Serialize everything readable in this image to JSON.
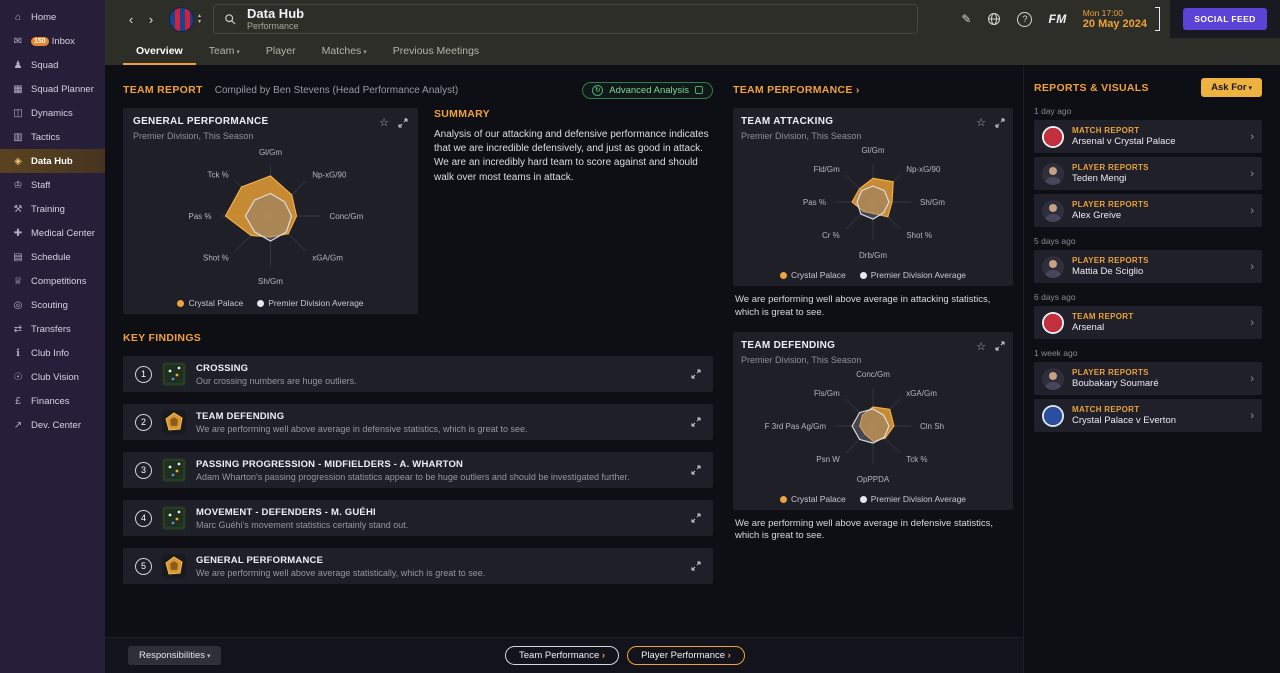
{
  "titlebar": {
    "title": "Data Hub",
    "subtitle": "Performance",
    "date_line1": "Mon 17:00",
    "date_line2": "20 May 2024",
    "fm_label": "FM",
    "social_feed_label": "SOCIAL FEED"
  },
  "sidebar": {
    "items": [
      {
        "label": "Home",
        "icon": "home-icon"
      },
      {
        "label": "Inbox",
        "icon": "inbox-icon",
        "badge": "150"
      },
      {
        "label": "Squad",
        "icon": "squad-icon"
      },
      {
        "label": "Squad Planner",
        "icon": "squad-planner-icon"
      },
      {
        "label": "Dynamics",
        "icon": "dynamics-icon"
      },
      {
        "label": "Tactics",
        "icon": "tactics-icon"
      },
      {
        "label": "Data Hub",
        "icon": "data-hub-icon",
        "active": true
      },
      {
        "label": "Staff",
        "icon": "staff-icon"
      },
      {
        "label": "Training",
        "icon": "training-icon"
      },
      {
        "label": "Medical Center",
        "icon": "medical-icon"
      },
      {
        "label": "Schedule",
        "icon": "schedule-icon"
      },
      {
        "label": "Competitions",
        "icon": "competitions-icon"
      },
      {
        "label": "Scouting",
        "icon": "scouting-icon"
      },
      {
        "label": "Transfers",
        "icon": "transfers-icon"
      },
      {
        "label": "Club Info",
        "icon": "club-info-icon"
      },
      {
        "label": "Club Vision",
        "icon": "club-vision-icon"
      },
      {
        "label": "Finances",
        "icon": "finances-icon"
      },
      {
        "label": "Dev. Center",
        "icon": "dev-center-icon"
      }
    ]
  },
  "tabs": [
    {
      "label": "Overview",
      "active": true
    },
    {
      "label": "Team",
      "dropdown": true
    },
    {
      "label": "Player"
    },
    {
      "label": "Matches",
      "dropdown": true
    },
    {
      "label": "Previous Meetings"
    }
  ],
  "team_report": {
    "title": "TEAM REPORT",
    "compiled_by": "Compiled by Ben Stevens (Head Performance Analyst)",
    "advanced_analysis_label": "Advanced Analysis"
  },
  "summary": {
    "title": "SUMMARY",
    "text": "Analysis of our attacking and defensive performance indicates that we are incredible defensively, and just as good in attack. We are an incredibly hard team to score against and should walk over most teams in attack."
  },
  "key_findings": {
    "title": "KEY FINDINGS",
    "items": [
      {
        "num": "1",
        "title": "CROSSING",
        "desc": "Our crossing numbers are huge outliers.",
        "thumb": "pitch"
      },
      {
        "num": "2",
        "title": "TEAM DEFENDING",
        "desc": "We are performing well above average in defensive statistics, which is great to see.",
        "thumb": "radar"
      },
      {
        "num": "3",
        "title": "PASSING PROGRESSION - MIDFIELDERS - A. WHARTON",
        "desc": "Adam Wharton's passing progression statistics appear to be huge outliers and should be investigated further.",
        "thumb": "pitch"
      },
      {
        "num": "4",
        "title": "MOVEMENT - DEFENDERS - M. GUÉHI",
        "desc": "Marc Guéhi's movement statistics certainly stand out.",
        "thumb": "pitch"
      },
      {
        "num": "5",
        "title": "GENERAL PERFORMANCE",
        "desc": "We are performing well above average statistically, which is great to see.",
        "thumb": "radar"
      }
    ]
  },
  "team_performance": {
    "header": "TEAM PERFORMANCE",
    "attacking_note": "We are performing well above average in attacking statistics, which is great to see.",
    "defending_note": "We are performing well above average in defensive statistics, which is great to see."
  },
  "reports": {
    "title": "REPORTS & VISUALS",
    "ask_for_label": "Ask For",
    "items": [
      {
        "type": "label",
        "text": "1 day ago"
      },
      {
        "type": "report",
        "kind": "MATCH REPORT",
        "name": "Arsenal v Crystal Palace",
        "icon": "arsenal-crest-icon"
      },
      {
        "type": "report",
        "kind": "PLAYER REPORTS",
        "name": "Teden Mengi",
        "icon": "player-avatar-icon"
      },
      {
        "type": "report",
        "kind": "PLAYER REPORTS",
        "name": "Alex Greive",
        "icon": "player-avatar-icon"
      },
      {
        "type": "label",
        "text": "5 days ago"
      },
      {
        "type": "report",
        "kind": "PLAYER REPORTS",
        "name": "Mattia De Sciglio",
        "icon": "player-avatar-icon"
      },
      {
        "type": "label",
        "text": "6 days ago"
      },
      {
        "type": "report",
        "kind": "TEAM REPORT",
        "name": "Arsenal",
        "icon": "arsenal-crest-icon"
      },
      {
        "type": "label",
        "text": "1 week ago"
      },
      {
        "type": "report",
        "kind": "PLAYER REPORTS",
        "name": "Boubakary Soumaré",
        "icon": "player-avatar-icon"
      },
      {
        "type": "report",
        "kind": "MATCH REPORT",
        "name": "Crystal Palace v Everton",
        "icon": "everton-crest-icon"
      }
    ]
  },
  "footer": {
    "responsibilities_label": "Responsibilities",
    "team_performance_label": "Team Performance",
    "player_performance_label": "Player Performance"
  },
  "chart_data": [
    {
      "type": "radar",
      "id": "general-performance",
      "title": "GENERAL PERFORMANCE",
      "subtitle": "Premier Division, This Season",
      "axes": [
        "Gl/Gm",
        "Np-xG/90",
        "Conc/Gm",
        "xGA/Gm",
        "Sh/Gm",
        "Shot %",
        "Pas %",
        "Tck %"
      ],
      "range": [
        0,
        1
      ],
      "series": [
        {
          "name": "Crystal Palace",
          "color": "#f2ae4a",
          "fill": "rgba(228,158,52,0.85)",
          "values": [
            0.8,
            0.6,
            0.52,
            0.5,
            0.42,
            0.55,
            0.9,
            0.82
          ]
        },
        {
          "name": "Premier Division Average",
          "color": "#dcdce4",
          "fill": "rgba(130,130,142,0.38)",
          "values": [
            0.45,
            0.4,
            0.42,
            0.45,
            0.5,
            0.45,
            0.5,
            0.45
          ]
        }
      ]
    },
    {
      "type": "radar",
      "id": "team-attacking",
      "title": "TEAM ATTACKING",
      "subtitle": "Premier Division, This Season",
      "axes": [
        "Gl/Gm",
        "Np-xG/90",
        "Sh/Gm",
        "Shot %",
        "Drb/Gm",
        "Cr %",
        "Pas %",
        "Fld/Gm"
      ],
      "range": [
        0,
        1
      ],
      "series": [
        {
          "name": "Crystal Palace",
          "color": "#f2ae4a",
          "fill": "rgba(228,158,52,0.85)",
          "values": [
            0.62,
            0.75,
            0.5,
            0.55,
            0.3,
            0.35,
            0.55,
            0.5
          ]
        },
        {
          "name": "Premier Division Average",
          "color": "#dcdce4",
          "fill": "rgba(130,130,142,0.38)",
          "values": [
            0.42,
            0.42,
            0.42,
            0.4,
            0.45,
            0.45,
            0.42,
            0.42
          ]
        }
      ]
    },
    {
      "type": "radar",
      "id": "team-defending",
      "title": "TEAM DEFENDING",
      "subtitle": "Premier Division, This Season",
      "axes": [
        "Conc/Gm",
        "xGA/Gm",
        "Cln Sh",
        "Tck %",
        "OpPPDA",
        "Psn W",
        "F 3rd Pas Ag/Gm",
        "Fls/Gm"
      ],
      "range": [
        0,
        1
      ],
      "series": [
        {
          "name": "Crystal Palace",
          "color": "#f2ae4a",
          "fill": "rgba(228,158,52,0.85)",
          "values": [
            0.5,
            0.62,
            0.55,
            0.45,
            0.4,
            0.3,
            0.35,
            0.4
          ]
        },
        {
          "name": "Premier Division Average",
          "color": "#dcdce4",
          "fill": "rgba(130,130,142,0.38)",
          "values": [
            0.45,
            0.4,
            0.42,
            0.42,
            0.45,
            0.5,
            0.55,
            0.5
          ]
        }
      ]
    }
  ]
}
